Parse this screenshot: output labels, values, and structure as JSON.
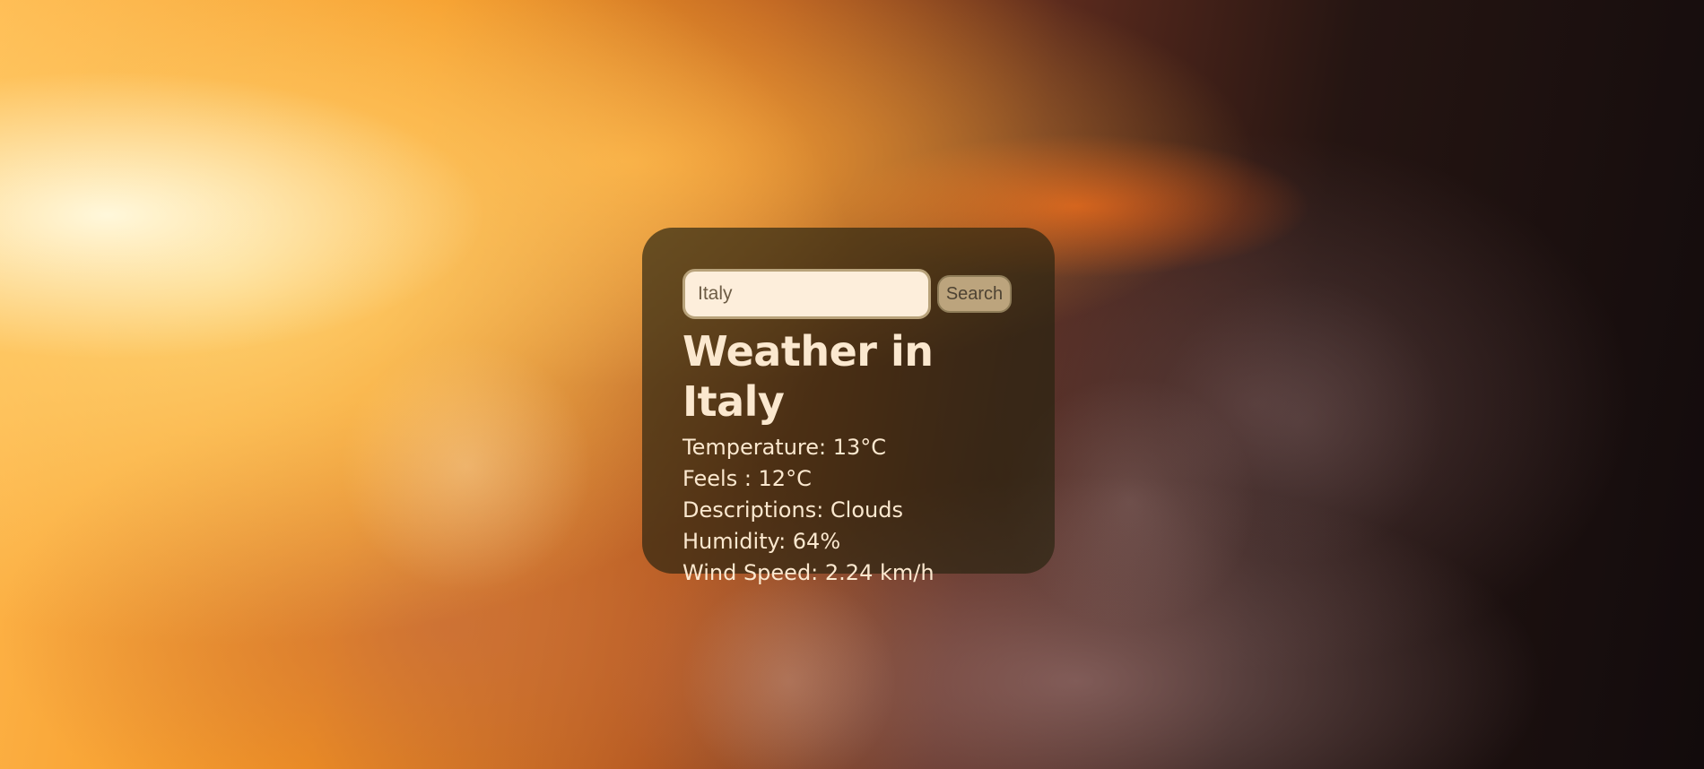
{
  "search": {
    "value": "Italy",
    "placeholder": "Search",
    "button_label": "Search"
  },
  "weather": {
    "title": "Weather in Italy",
    "temperature": "Temperature: 13°C",
    "feels": "Feels : 12°C",
    "description": "Descriptions: Clouds",
    "humidity": "Humidity: 64%",
    "wind_speed": "Wind Speed: 2.24 km/h"
  },
  "colors": {
    "card_background": "#28240f",
    "text": "#fbe8cf",
    "input_background": "#fdeedb",
    "button_background": "#bca47d"
  }
}
